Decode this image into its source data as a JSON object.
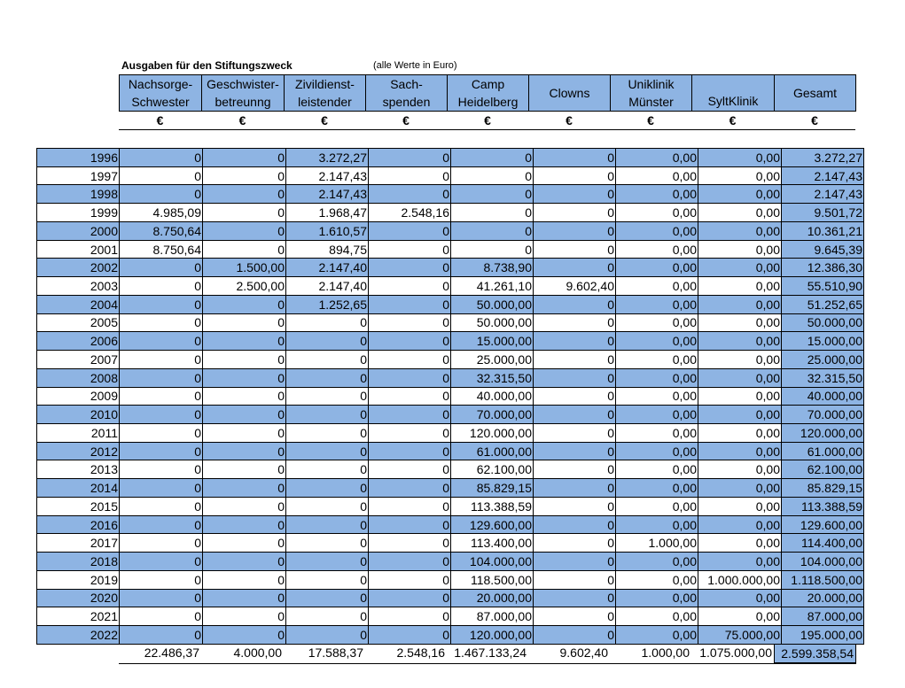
{
  "title": "Ausgaben für den Stiftungszweck",
  "subtitle": "(alle Werte in Euro)",
  "columns": [
    {
      "label": "Nachsorge-\nSchwester",
      "currency": "€"
    },
    {
      "label": "Geschwister-\nbetreunng",
      "currency": "€"
    },
    {
      "label": "Zivildienst-\nleistender",
      "currency": "€"
    },
    {
      "label": "Sach-\nspenden",
      "currency": "€"
    },
    {
      "label": "Camp\nHeidelberg",
      "currency": "€"
    },
    {
      "label": "Clowns",
      "currency": "€"
    },
    {
      "label": "Uniklinik\nMünster",
      "currency": "€"
    },
    {
      "label": "SyltKlinik",
      "currency": "€"
    },
    {
      "label": "Gesamt",
      "currency": "€"
    }
  ],
  "rows": [
    {
      "year": "1996",
      "values": [
        "0",
        "0",
        "3.272,27",
        "0",
        "0",
        "0",
        "0,00",
        "0,00",
        "3.272,27"
      ]
    },
    {
      "year": "1997",
      "values": [
        "0",
        "0",
        "2.147,43",
        "0",
        "0",
        "0",
        "0,00",
        "0,00",
        "2.147,43"
      ]
    },
    {
      "year": "1998",
      "values": [
        "0",
        "0",
        "2.147,43",
        "0",
        "0",
        "0",
        "0,00",
        "0,00",
        "2.147,43"
      ]
    },
    {
      "year": "1999",
      "values": [
        "4.985,09",
        "0",
        "1.968,47",
        "2.548,16",
        "0",
        "0",
        "0,00",
        "0,00",
        "9.501,72"
      ]
    },
    {
      "year": "2000",
      "values": [
        "8.750,64",
        "0",
        "1.610,57",
        "0",
        "0",
        "0",
        "0,00",
        "0,00",
        "10.361,21"
      ]
    },
    {
      "year": "2001",
      "values": [
        "8.750,64",
        "0",
        "894,75",
        "0",
        "0",
        "0",
        "0,00",
        "0,00",
        "9.645,39"
      ]
    },
    {
      "year": "2002",
      "values": [
        "0",
        "1.500,00",
        "2.147,40",
        "0",
        "8.738,90",
        "0",
        "0,00",
        "0,00",
        "12.386,30"
      ]
    },
    {
      "year": "2003",
      "values": [
        "0",
        "2.500,00",
        "2.147,40",
        "0",
        "41.261,10",
        "9.602,40",
        "0,00",
        "0,00",
        "55.510,90"
      ]
    },
    {
      "year": "2004",
      "values": [
        "0",
        "0",
        "1.252,65",
        "0",
        "50.000,00",
        "0",
        "0,00",
        "0,00",
        "51.252,65"
      ]
    },
    {
      "year": "2005",
      "values": [
        "0",
        "0",
        "0",
        "0",
        "50.000,00",
        "0",
        "0,00",
        "0,00",
        "50.000,00"
      ]
    },
    {
      "year": "2006",
      "values": [
        "0",
        "0",
        "0",
        "0",
        "15.000,00",
        "0",
        "0,00",
        "0,00",
        "15.000,00"
      ]
    },
    {
      "year": "2007",
      "values": [
        "0",
        "0",
        "0",
        "0",
        "25.000,00",
        "0",
        "0,00",
        "0,00",
        "25.000,00"
      ]
    },
    {
      "year": "2008",
      "values": [
        "0",
        "0",
        "0",
        "0",
        "32.315,50",
        "0",
        "0,00",
        "0,00",
        "32.315,50"
      ]
    },
    {
      "year": "2009",
      "values": [
        "0",
        "0",
        "0",
        "0",
        "40.000,00",
        "0",
        "0,00",
        "0,00",
        "40.000,00"
      ]
    },
    {
      "year": "2010",
      "values": [
        "0",
        "0",
        "0",
        "0",
        "70.000,00",
        "0",
        "0,00",
        "0,00",
        "70.000,00"
      ]
    },
    {
      "year": "2011",
      "values": [
        "0",
        "0",
        "0",
        "0",
        "120.000,00",
        "0",
        "0,00",
        "0,00",
        "120.000,00"
      ]
    },
    {
      "year": "2012",
      "values": [
        "0",
        "0",
        "0",
        "0",
        "61.000,00",
        "0",
        "0,00",
        "0,00",
        "61.000,00"
      ]
    },
    {
      "year": "2013",
      "values": [
        "0",
        "0",
        "0",
        "0",
        "62.100,00",
        "0",
        "0,00",
        "0,00",
        "62.100,00"
      ]
    },
    {
      "year": "2014",
      "values": [
        "0",
        "0",
        "0",
        "0",
        "85.829,15",
        "0",
        "0,00",
        "0,00",
        "85.829,15"
      ]
    },
    {
      "year": "2015",
      "values": [
        "0",
        "0",
        "0",
        "0",
        "113.388,59",
        "0",
        "0,00",
        "0,00",
        "113.388,59"
      ]
    },
    {
      "year": "2016",
      "values": [
        "0",
        "0",
        "0",
        "0",
        "129.600,00",
        "0",
        "0,00",
        "0,00",
        "129.600,00"
      ]
    },
    {
      "year": "2017",
      "values": [
        "0",
        "0",
        "0",
        "0",
        "113.400,00",
        "0",
        "1.000,00",
        "0,00",
        "114.400,00"
      ]
    },
    {
      "year": "2018",
      "values": [
        "0",
        "0",
        "0",
        "0",
        "104.000,00",
        "0",
        "0,00",
        "0,00",
        "104.000,00"
      ]
    },
    {
      "year": "2019",
      "values": [
        "0",
        "0",
        "0",
        "0",
        "118.500,00",
        "0",
        "0,00",
        "1.000.000,00",
        "1.118.500,00"
      ]
    },
    {
      "year": "2020",
      "values": [
        "0",
        "0",
        "0",
        "0",
        "20.000,00",
        "0",
        "0,00",
        "0,00",
        "20.000,00"
      ]
    },
    {
      "year": "2021",
      "values": [
        "0",
        "0",
        "0",
        "0",
        "87.000,00",
        "0",
        "0,00",
        "0,00",
        "87.000,00"
      ]
    },
    {
      "year": "2022",
      "values": [
        "0",
        "0",
        "0",
        "0",
        "120.000,00",
        "0",
        "0,00",
        "75.000,00",
        "195.000,00"
      ]
    }
  ],
  "totals": [
    "22.486,37",
    "4.000,00",
    "17.588,37",
    "2.548,16",
    "1.467.133,24",
    "9.602,40",
    "1.000,00",
    "1.075.000,00",
    "2.599.358,54"
  ],
  "colors": {
    "band": "#8eb4e3",
    "border": "#000000"
  }
}
